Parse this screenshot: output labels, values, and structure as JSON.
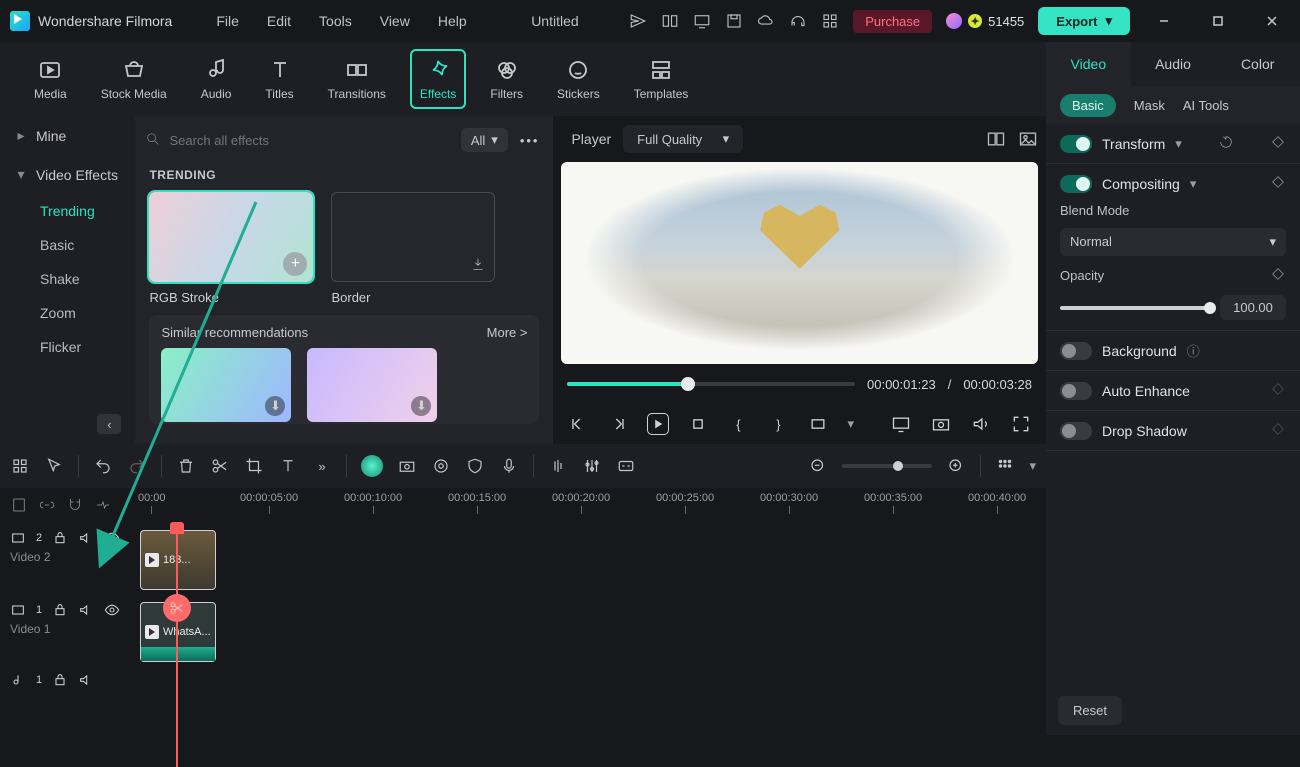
{
  "app": {
    "name": "Wondershare Filmora",
    "doc_title": "Untitled"
  },
  "menus": [
    "File",
    "Edit",
    "Tools",
    "View",
    "Help"
  ],
  "top": {
    "purchase": "Purchase",
    "coins": "51455",
    "export": "Export"
  },
  "ribbon": [
    {
      "id": "media",
      "label": "Media"
    },
    {
      "id": "stock",
      "label": "Stock Media"
    },
    {
      "id": "audio",
      "label": "Audio"
    },
    {
      "id": "titles",
      "label": "Titles"
    },
    {
      "id": "transitions",
      "label": "Transitions"
    },
    {
      "id": "effects",
      "label": "Effects"
    },
    {
      "id": "filters",
      "label": "Filters"
    },
    {
      "id": "stickers",
      "label": "Stickers"
    },
    {
      "id": "templates",
      "label": "Templates"
    }
  ],
  "nav": {
    "mine": "Mine",
    "video_effects": "Video Effects",
    "subs": [
      "Trending",
      "Basic",
      "Shake",
      "Zoom",
      "Flicker"
    ]
  },
  "browser": {
    "search_placeholder": "Search all effects",
    "filter": "All",
    "sections": {
      "trending": "TRENDING",
      "similar": "Similar recommendations",
      "more": "More >"
    },
    "items": [
      {
        "id": "rgb",
        "label": "RGB Stroke"
      },
      {
        "id": "border",
        "label": "Border"
      }
    ]
  },
  "player": {
    "label": "Player",
    "quality": "Full Quality",
    "time_current": "00:00:01:23",
    "time_sep": "/",
    "time_total": "00:00:03:28"
  },
  "ruler": {
    "marks": [
      "00:00",
      "00:00:05:00",
      "00:00:10:00",
      "00:00:15:00",
      "00:00:20:00",
      "00:00:25:00",
      "00:00:30:00",
      "00:00:35:00",
      "00:00:40:00"
    ]
  },
  "tracks": {
    "v2": {
      "name": "Video 2",
      "num": "2",
      "clip": "183..."
    },
    "v1": {
      "name": "Video 1",
      "num": "1",
      "clip": "WhatsA..."
    },
    "a1": {
      "num": "1"
    }
  },
  "inspector": {
    "tabs": [
      "Video",
      "Audio",
      "Color"
    ],
    "subtabs": [
      "Basic",
      "Mask",
      "AI Tools"
    ],
    "transform": "Transform",
    "compositing": "Compositing",
    "blend_label": "Blend Mode",
    "blend_value": "Normal",
    "opacity_label": "Opacity",
    "opacity_value": "100.00",
    "background": "Background",
    "auto_enhance": "Auto Enhance",
    "drop_shadow": "Drop Shadow",
    "reset": "Reset"
  }
}
